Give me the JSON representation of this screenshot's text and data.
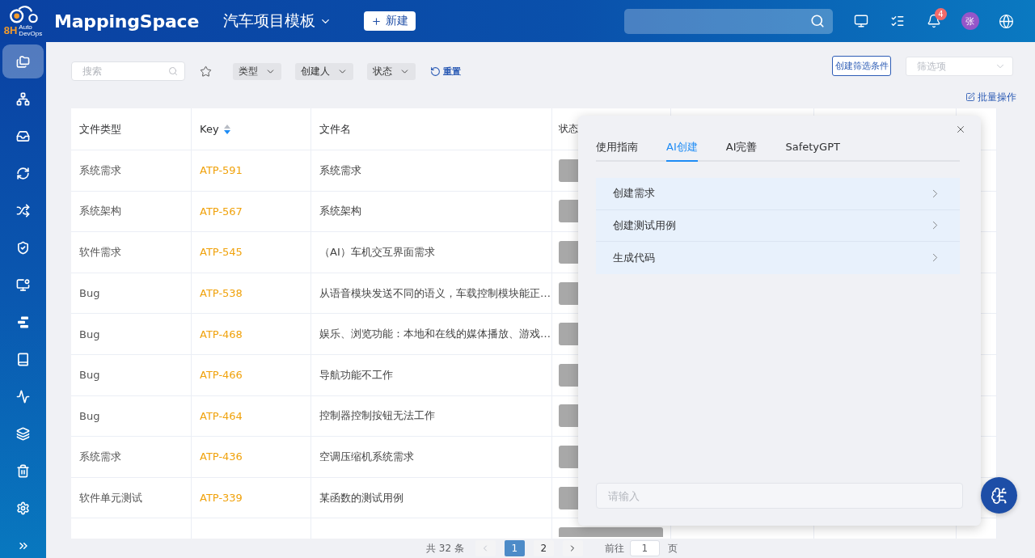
{
  "header": {
    "logo": {
      "mark": "8H",
      "caption": [
        "Auto",
        "DevOps"
      ]
    },
    "brand": "MappingSpace",
    "project": "汽车项目模板",
    "new_button": "新建",
    "notifications": {
      "badge": "4"
    },
    "avatar": "张"
  },
  "sidebar": {
    "items": [
      {
        "selected": true
      },
      {
        "selected": false
      },
      {
        "selected": false
      },
      {
        "selected": false
      },
      {
        "selected": false
      },
      {
        "selected": false
      },
      {
        "selected": false
      },
      {
        "selected": false
      },
      {
        "selected": false
      },
      {
        "selected": false
      },
      {
        "selected": false
      },
      {
        "selected": false
      },
      {
        "selected": false
      }
    ]
  },
  "filters": {
    "search": {
      "placeholder": "搜索"
    },
    "dropdowns": [
      "类型",
      "创建人",
      "状态"
    ],
    "reset": "重置",
    "create_filter": "创建筛选条件",
    "saved_filter": {
      "placeholder": "筛选项"
    },
    "batch": "批量操作"
  },
  "table": {
    "columns": [
      {
        "label": "文件类型"
      },
      {
        "label": "Key",
        "sort_descending": true
      },
      {
        "label": "文件名"
      },
      {
        "label": "状态"
      }
    ],
    "rows": [
      {
        "type": "系统需求",
        "key": "ATP-591",
        "name": "系统需求"
      },
      {
        "type": "系统架构",
        "key": "ATP-567",
        "name": "系统架构"
      },
      {
        "type": "软件需求",
        "key": "ATP-545",
        "name": "（AI）车机交互界面需求"
      },
      {
        "type": "Bug",
        "key": "ATP-538",
        "name": "从语音模块发送不同的语义，车载控制模块能正…"
      },
      {
        "type": "Bug",
        "key": "ATP-468",
        "name": "娱乐、浏览功能：本地和在线的媒体播放、游戏…"
      },
      {
        "type": "Bug",
        "key": "ATP-466",
        "name": "导航功能不工作"
      },
      {
        "type": "Bug",
        "key": "ATP-464",
        "name": "控制器控制按钮无法工作"
      },
      {
        "type": "系统需求",
        "key": "ATP-436",
        "name": "空调压缩机系统需求"
      },
      {
        "type": "软件单元测试",
        "key": "ATP-339",
        "name": "某函数的测试用例"
      }
    ]
  },
  "ai_panel": {
    "tabs": [
      {
        "label": "使用指南",
        "selected": false
      },
      {
        "label": "AI创建",
        "selected": true
      },
      {
        "label": "AI完善",
        "selected": false
      },
      {
        "label": "SafetyGPT",
        "selected": false
      }
    ],
    "actions": [
      "创建需求",
      "创建测试用例",
      "生成代码"
    ],
    "input": {
      "placeholder": "请输入"
    }
  },
  "pagination": {
    "total": "共 32 条",
    "prev": {
      "disabled": true
    },
    "pages": [
      {
        "label": "1",
        "selected": true
      },
      {
        "label": "2",
        "selected": false
      }
    ],
    "goto_label": "前往",
    "goto_value": "1",
    "goto_unit": "页"
  }
}
